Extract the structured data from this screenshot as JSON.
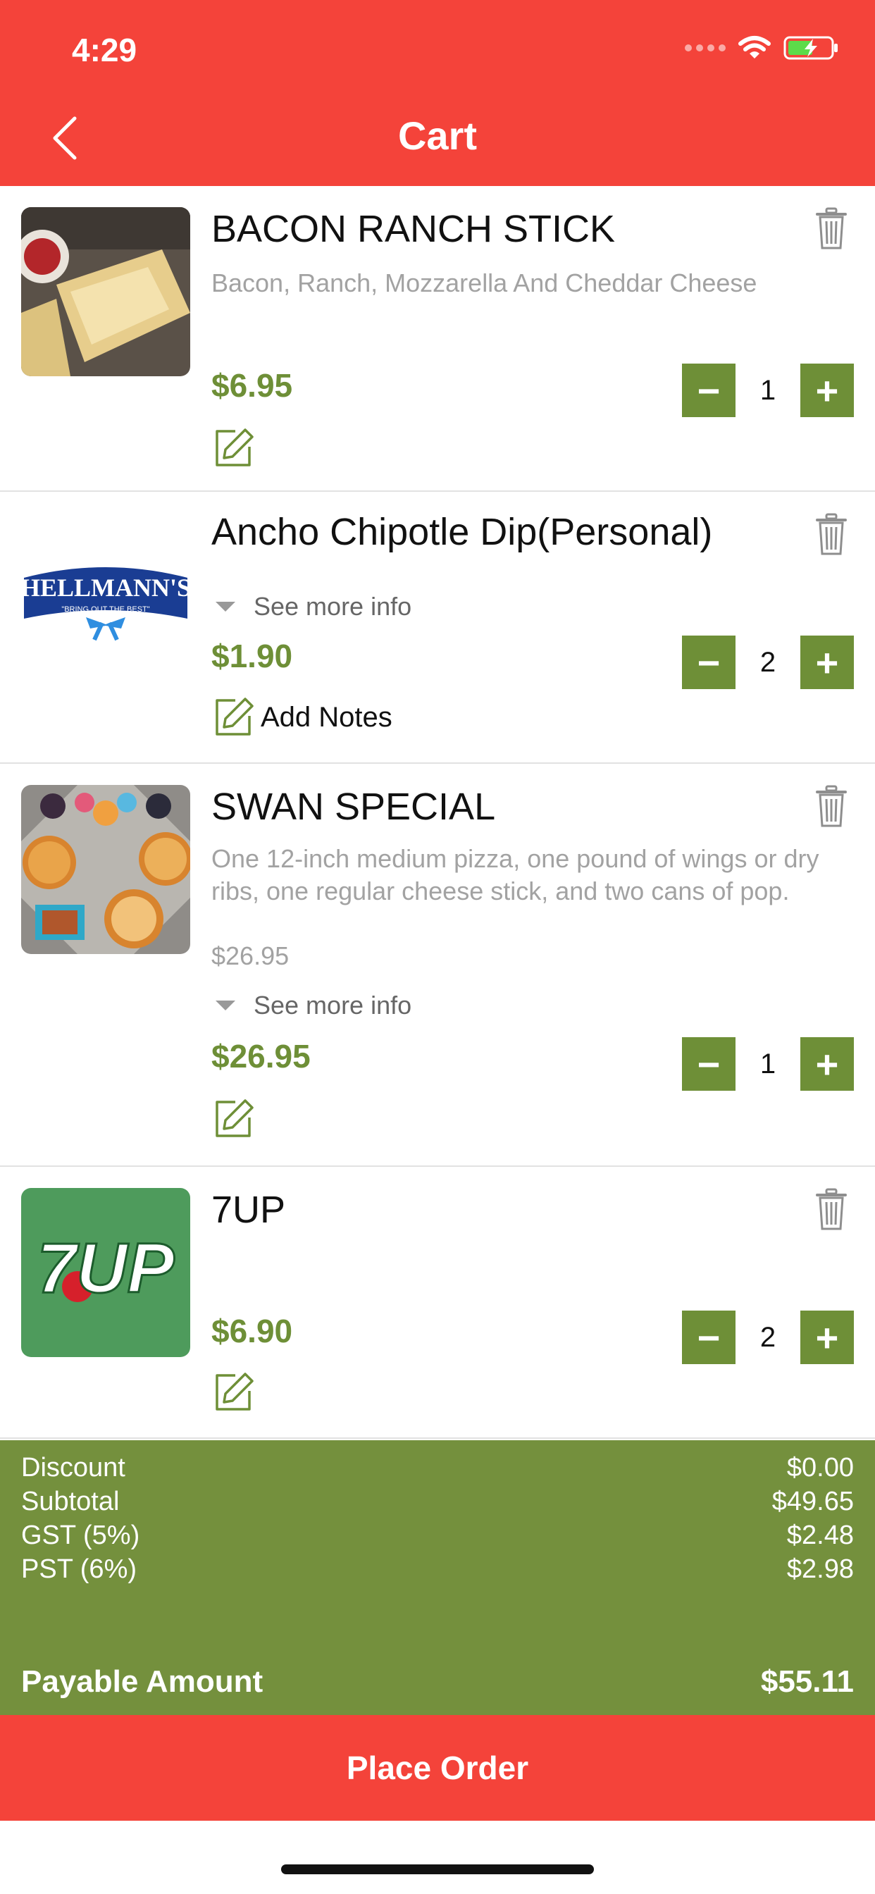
{
  "status_bar": {
    "time": "4:29"
  },
  "header": {
    "title": "Cart"
  },
  "colors": {
    "header_red": "#f4433a",
    "accent_green": "#6e8f37",
    "summary_green": "#74903d"
  },
  "items": [
    {
      "name": "BACON RANCH STICK",
      "description": "Bacon, Ranch, Mozzarella And Cheddar Cheese",
      "price": "$6.95",
      "quantity": "1",
      "note_label": "",
      "image": "bacon-ranch-stick-photo"
    },
    {
      "name": "Ancho Chipotle Dip(Personal)",
      "see_more": "See more info",
      "price": "$1.90",
      "quantity": "2",
      "note_label": "Add Notes",
      "image": "hellmanns-logo",
      "logo_text": "HELLMANN'S",
      "logo_tagline": "\"BRING OUT THE BEST\""
    },
    {
      "name": "SWAN SPECIAL",
      "description": "One 12-inch medium pizza, one pound of wings or dry ribs, one regular cheese stick, and two cans of pop.",
      "sub_price": "$26.95",
      "see_more": "See more info",
      "price": "$26.95",
      "quantity": "1",
      "note_label": "",
      "image": "swan-special-photo"
    },
    {
      "name": "7UP",
      "price": "$6.90",
      "quantity": "2",
      "note_label": "",
      "image": "7up-logo",
      "logo_text": "7UP"
    }
  ],
  "controls": {
    "minus": "−",
    "plus": "+"
  },
  "summary": {
    "rows": [
      {
        "label": "Discount",
        "value": "$0.00"
      },
      {
        "label": "Subtotal",
        "value": "$49.65"
      },
      {
        "label": "GST (5%)",
        "value": "$2.48"
      },
      {
        "label": "PST (6%)",
        "value": "$2.98"
      }
    ],
    "payable_label": "Payable Amount",
    "payable_value": "$55.11"
  },
  "place_order_label": "Place Order"
}
